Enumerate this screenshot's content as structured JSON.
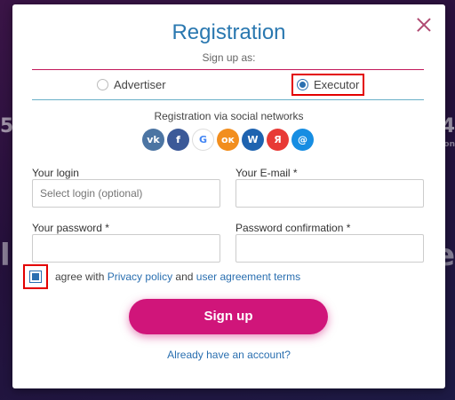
{
  "background": {
    "left_digit": "5",
    "right_digit": "4",
    "right_small": "on",
    "left_letter": "l",
    "right_letter": "e"
  },
  "modal": {
    "title": "Registration",
    "subtitle": "Sign up as:",
    "roles": {
      "advertiser": {
        "label": "Advertiser",
        "selected": false
      },
      "executor": {
        "label": "Executor",
        "selected": true
      }
    },
    "social_title": "Registration via social networks",
    "socials": [
      {
        "name": "vk-icon",
        "glyph": "vk",
        "color": "#4c75a3"
      },
      {
        "name": "facebook-icon",
        "glyph": "f",
        "color": "#3b5998"
      },
      {
        "name": "google-icon",
        "glyph": "G",
        "color": "#ffffff"
      },
      {
        "name": "odnoklassniki-icon",
        "glyph": "ок",
        "color": "#f28e1e"
      },
      {
        "name": "webmoney-icon",
        "glyph": "W",
        "color": "#1e63b0"
      },
      {
        "name": "yandex-icon",
        "glyph": "Я",
        "color": "#e83a36"
      },
      {
        "name": "mailru-icon",
        "glyph": "@",
        "color": "#168de2"
      }
    ],
    "fields": {
      "login": {
        "label": "Your login",
        "placeholder": "Select login (optional)",
        "value": ""
      },
      "email": {
        "label": "Your E-mail *",
        "placeholder": "",
        "value": ""
      },
      "password": {
        "label": "Your password *",
        "placeholder": "",
        "value": ""
      },
      "password_confirm": {
        "label": "Password confirmation *",
        "placeholder": "",
        "value": ""
      }
    },
    "agree": {
      "checked": true,
      "prefix": "agree with",
      "privacy_link": "Privacy policy",
      "middle": "and",
      "terms_link": "user agreement terms"
    },
    "signup_button": "Sign up",
    "already_link": "Already have an account?"
  },
  "colors": {
    "accent_blue": "#2a78b0",
    "accent_pink": "#d0157a",
    "highlight_red": "#e30000"
  }
}
